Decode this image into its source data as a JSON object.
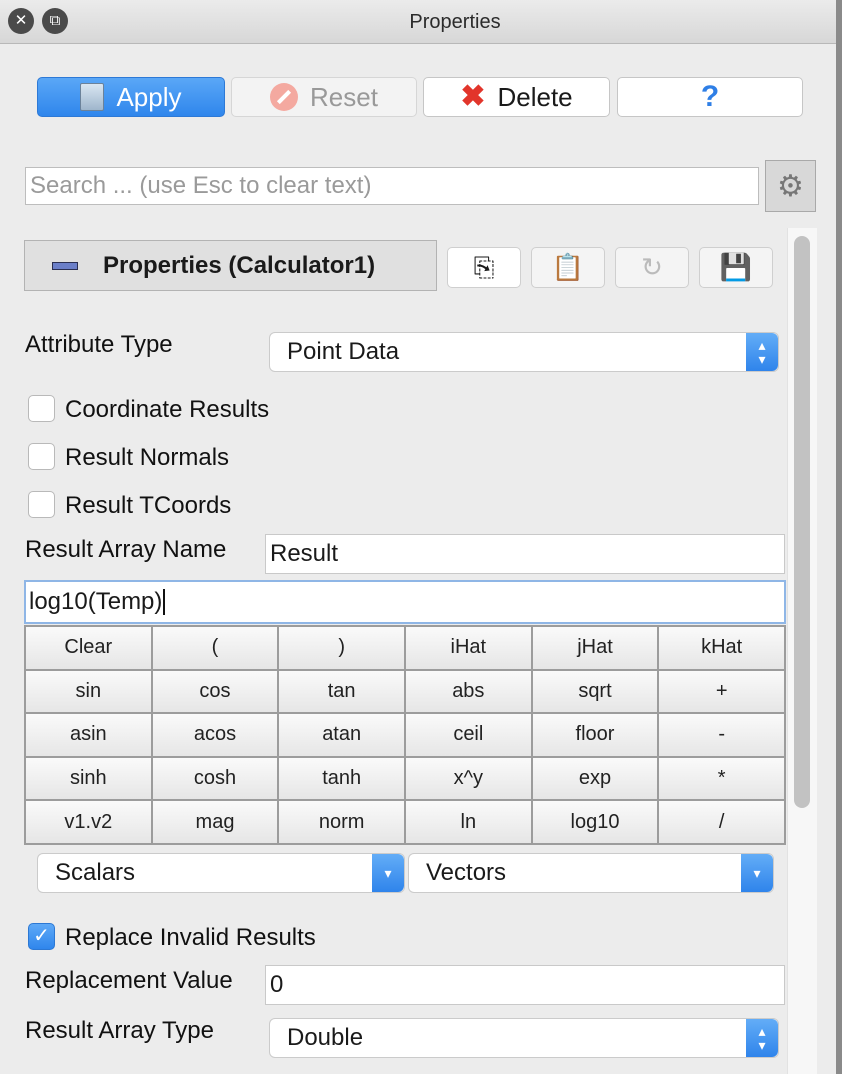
{
  "window": {
    "title": "Properties",
    "close_glyph": "✕",
    "restore_glyph": "⧉"
  },
  "toolbar": {
    "apply_label": "Apply",
    "reset_label": "Reset",
    "delete_label": "Delete",
    "help_label": "?"
  },
  "search": {
    "placeholder": "Search ... (use Esc to clear text)"
  },
  "properties_header": {
    "title": "Properties (Calculator1)"
  },
  "attribute_type": {
    "label": "Attribute Type",
    "value": "Point Data"
  },
  "checkboxes": [
    {
      "label": "Coordinate Results",
      "checked": false
    },
    {
      "label": "Result Normals",
      "checked": false
    },
    {
      "label": "Result TCoords",
      "checked": false
    }
  ],
  "result_array_name": {
    "label": "Result Array Name",
    "value": "Result"
  },
  "expression": {
    "value": "log10(Temp)"
  },
  "calculator_buttons": [
    [
      "Clear",
      "(",
      ")",
      "iHat",
      "jHat",
      "kHat"
    ],
    [
      "sin",
      "cos",
      "tan",
      "abs",
      "sqrt",
      "+"
    ],
    [
      "asin",
      "acos",
      "atan",
      "ceil",
      "floor",
      "-"
    ],
    [
      "sinh",
      "cosh",
      "tanh",
      "x^y",
      "exp",
      "*"
    ],
    [
      "v1.v2",
      "mag",
      "norm",
      "ln",
      "log10",
      "/"
    ]
  ],
  "scalars_select": {
    "value": "Scalars"
  },
  "vectors_select": {
    "value": "Vectors"
  },
  "replace_invalid": {
    "label": "Replace Invalid Results",
    "checked": true
  },
  "replacement_value": {
    "label": "Replacement Value",
    "value": "0"
  },
  "result_array_type": {
    "label": "Result Array Type",
    "value": "Double"
  },
  "colors": {
    "accent": "#2f86ec",
    "delete_icon": "#e2352b"
  }
}
